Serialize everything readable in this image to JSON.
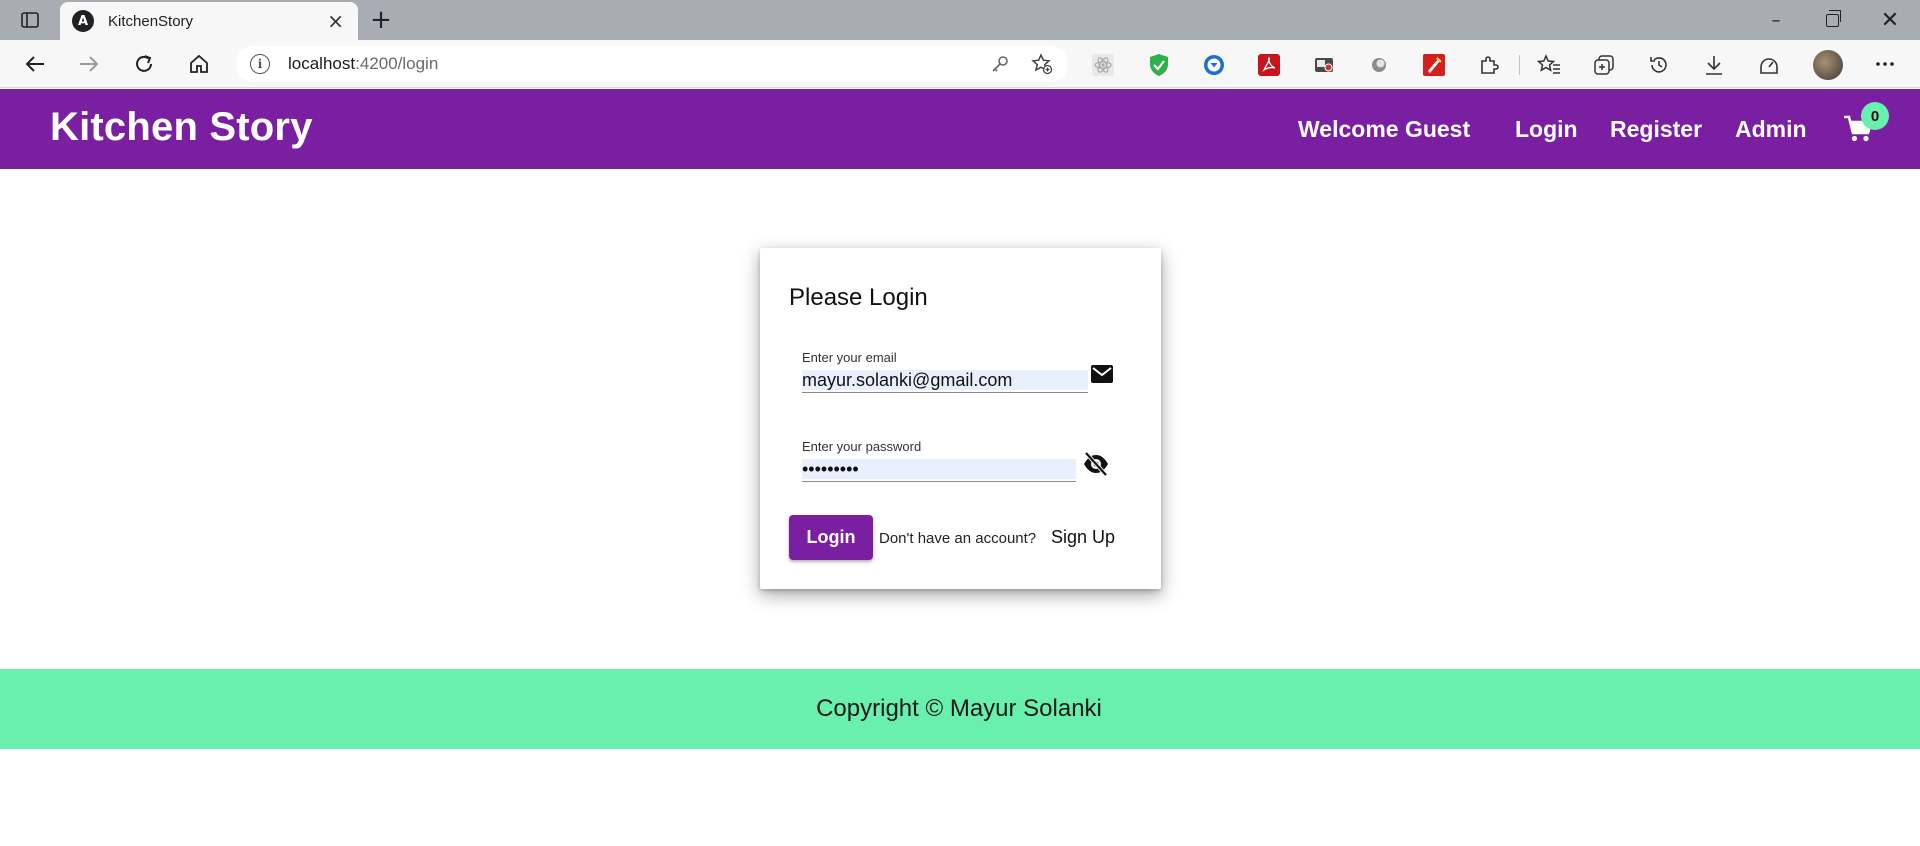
{
  "browser": {
    "tab_icon_letter": "A",
    "tab_title": "KitchenStory",
    "tab_close": "×",
    "new_tab": "+",
    "url_host": "localhost",
    "url_path": ":4200/login",
    "min": "–",
    "close": "✕",
    "icons": [
      "sidebar-icon",
      "angular-icon",
      "close-icon",
      "plus-icon",
      "back-icon",
      "forward-icon",
      "refresh-icon",
      "home-icon",
      "info-icon",
      "key-icon",
      "add-favorite-icon",
      "react-devtools-icon",
      "shield-extension-icon",
      "download-extension-icon",
      "pdf-extension-icon",
      "camera-extension-icon",
      "circle-extension-icon",
      "pen-extension-icon",
      "extensions-icon",
      "favorites-icon",
      "collections-icon",
      "history-icon",
      "downloads-icon",
      "performance-icon",
      "profile-avatar",
      "more-icon"
    ]
  },
  "header": {
    "brand": "Kitchen Story",
    "welcome": "Welcome Guest",
    "login": "Login",
    "register": "Register",
    "admin": "Admin",
    "cart_count": "0",
    "colors": {
      "primary": "#7b1fa2",
      "accent": "#69f0ae"
    }
  },
  "login_card": {
    "title": "Please Login",
    "email_label": "Enter your email",
    "email_value": "mayur.solanki@gmail.com",
    "password_label": "Enter your password",
    "password_value": "•••••••••",
    "login_button": "Login",
    "no_account": "Don't have an account?",
    "signup": "Sign Up"
  },
  "footer": {
    "copyright": "Copyright © Mayur Solanki"
  }
}
